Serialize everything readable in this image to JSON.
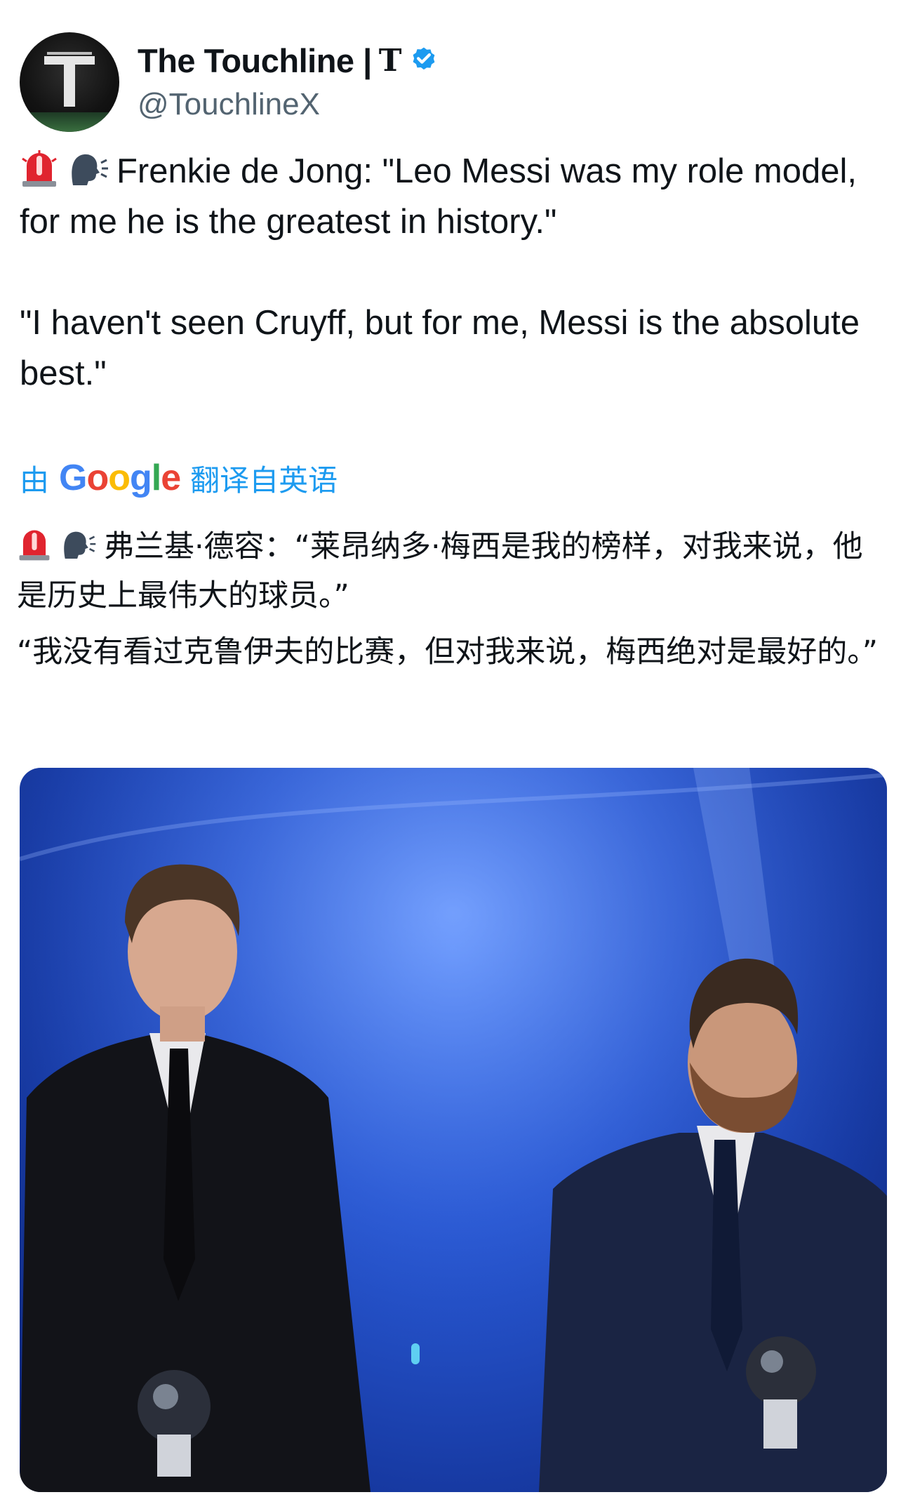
{
  "author": {
    "display_name": "The Touchline | ",
    "affiliation": "T",
    "handle": "@TouchlineX",
    "avatar_letter": "T",
    "verified": true
  },
  "tweet": {
    "line1": "Frenkie de Jong: \"Leo Messi was my role model, for me he is the greatest in history.\"",
    "line2": "\"I haven't seen Cruyff, but for me, Messi is the absolute best.\""
  },
  "translation": {
    "prefix": "由",
    "provider": "Google",
    "suffix": "翻译自英语",
    "line1": "弗兰基·德容：“莱昂纳多·梅西是我的榜样，对我来说，他是历史上最伟大的球员。”",
    "line2": "“我没有看过克鲁伊夫的比赛，但对我来说，梅西绝对是最好的。”"
  },
  "icons": {
    "emoji_1": "police-light-emoji",
    "emoji_2": "speaking-head-emoji",
    "badge": "verified-badge-icon"
  },
  "colors": {
    "link": "#1d9bf0",
    "verified": "#1d9bf0",
    "secondary_text": "#536471"
  },
  "media": {
    "description": "Two men in suits on a blue-lit stage holding trophies"
  }
}
